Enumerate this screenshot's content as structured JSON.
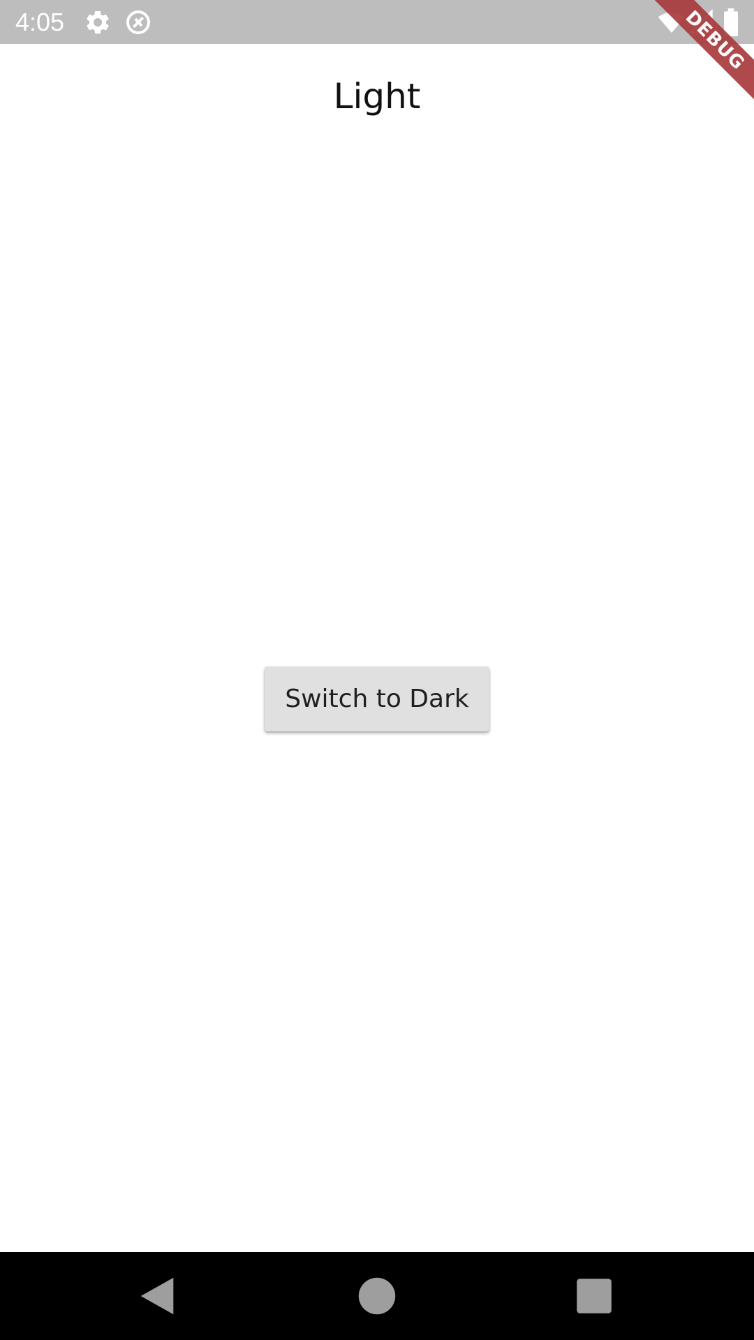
{
  "status_bar": {
    "time": "4:05",
    "icons": [
      "gear-icon",
      "no-location-icon",
      "wifi-icon",
      "signal-icon",
      "battery-icon"
    ],
    "background": "#bdbdbd"
  },
  "debug_banner": {
    "label": "DEBUG",
    "color": "#a83a3d"
  },
  "main": {
    "title": "Light",
    "button_label": "Switch to Dark",
    "background": "#ffffff"
  },
  "nav_bar": {
    "buttons": [
      "back-icon",
      "home-icon",
      "recents-icon"
    ],
    "background": "#000000"
  }
}
